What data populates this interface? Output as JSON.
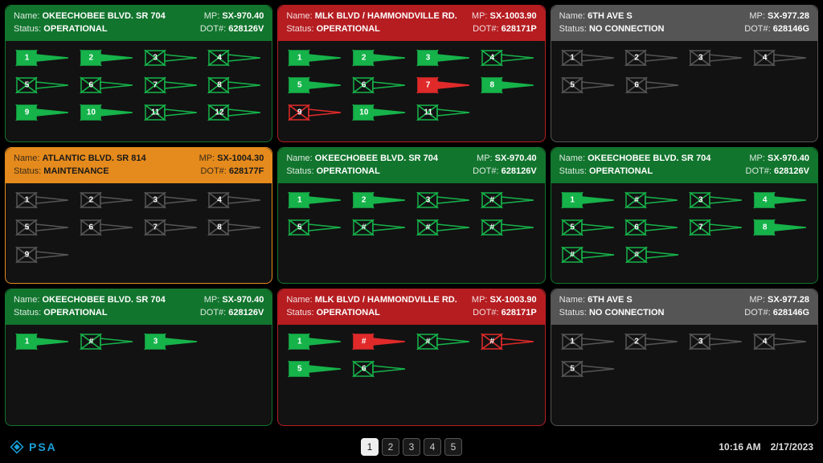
{
  "labels": {
    "name": "Name:",
    "status": "Status:",
    "mp": "MP:",
    "dot": "DOT#:"
  },
  "colors": {
    "green_fill": "#16b34a",
    "green_stroke": "#16b34a",
    "red_fill": "#e02a2a",
    "red_stroke": "#e02a2a",
    "grey_stroke": "#555555",
    "none": "none"
  },
  "footer": {
    "brand": "PSA",
    "pages": [
      "1",
      "2",
      "3",
      "4",
      "5"
    ],
    "active_page": 0,
    "time": "10:16 AM",
    "date": "2/17/2023"
  },
  "cards": [
    {
      "header_class": "green",
      "name": "OKEECHOBEE BLVD. SR 704",
      "status": "OPERATIONAL",
      "mp": "SX-970.40",
      "dot": "628126V",
      "rows": [
        [
          {
            "n": "1",
            "s": "gf"
          },
          {
            "n": "2",
            "s": "gf"
          },
          {
            "n": "3",
            "s": "go"
          },
          {
            "n": "4",
            "s": "go"
          }
        ],
        [
          {
            "n": "5",
            "s": "go"
          },
          {
            "n": "6",
            "s": "go"
          },
          {
            "n": "7",
            "s": "go"
          },
          {
            "n": "8",
            "s": "go"
          }
        ],
        [
          {
            "n": "9",
            "s": "gf"
          },
          {
            "n": "10",
            "s": "gf"
          },
          {
            "n": "11",
            "s": "go"
          },
          {
            "n": "12",
            "s": "go"
          }
        ]
      ]
    },
    {
      "header_class": "red",
      "name": "MLK BLVD / HAMMONDVILLE RD.",
      "status": "OPERATIONAL",
      "mp": "SX-1003.90",
      "dot": "628171P",
      "rows": [
        [
          {
            "n": "1",
            "s": "gf"
          },
          {
            "n": "2",
            "s": "gf"
          },
          {
            "n": "3",
            "s": "gf"
          },
          {
            "n": "4",
            "s": "go"
          }
        ],
        [
          {
            "n": "5",
            "s": "gf"
          },
          {
            "n": "6",
            "s": "go"
          },
          {
            "n": "7",
            "s": "rf"
          },
          {
            "n": "8",
            "s": "gf"
          }
        ],
        [
          {
            "n": "9",
            "s": "ro"
          },
          {
            "n": "10",
            "s": "gf"
          },
          {
            "n": "11",
            "s": "go"
          }
        ]
      ]
    },
    {
      "header_class": "grey",
      "name": "6TH AVE S",
      "status": "NO CONNECTION",
      "mp": "SX-977.28",
      "dot": "628146G",
      "rows": [
        [
          {
            "n": "1",
            "s": "xo"
          },
          {
            "n": "2",
            "s": "xo"
          },
          {
            "n": "3",
            "s": "xo"
          },
          {
            "n": "4",
            "s": "xo"
          }
        ],
        [
          {
            "n": "5",
            "s": "xo"
          },
          {
            "n": "6",
            "s": "xo"
          }
        ]
      ]
    },
    {
      "header_class": "orange",
      "name": "ATLANTIC BLVD. SR 814",
      "status": "MAINTENANCE",
      "mp": "SX-1004.30",
      "dot": "628177F",
      "rows": [
        [
          {
            "n": "1",
            "s": "xo"
          },
          {
            "n": "2",
            "s": "xo"
          },
          {
            "n": "3",
            "s": "xo"
          },
          {
            "n": "4",
            "s": "xo"
          }
        ],
        [
          {
            "n": "5",
            "s": "xo"
          },
          {
            "n": "6",
            "s": "xo"
          },
          {
            "n": "7",
            "s": "xo"
          },
          {
            "n": "8",
            "s": "xo"
          }
        ],
        [
          {
            "n": "9",
            "s": "xo"
          }
        ]
      ]
    },
    {
      "header_class": "green",
      "name": "OKEECHOBEE BLVD. SR 704",
      "status": "OPERATIONAL",
      "mp": "SX-970.40",
      "dot": "628126V",
      "rows": [
        [
          {
            "n": "1",
            "s": "gf"
          },
          {
            "n": "2",
            "s": "gf"
          },
          {
            "n": "3",
            "s": "go"
          },
          {
            "n": "#",
            "s": "go"
          }
        ],
        [
          {
            "n": "5",
            "s": "go"
          },
          {
            "n": "#",
            "s": "go"
          },
          {
            "n": "#",
            "s": "go"
          },
          {
            "n": "#",
            "s": "go"
          }
        ]
      ]
    },
    {
      "header_class": "green",
      "name": "OKEECHOBEE BLVD. SR 704",
      "status": "OPERATIONAL",
      "mp": "SX-970.40",
      "dot": "628126V",
      "rows": [
        [
          {
            "n": "1",
            "s": "gf"
          },
          {
            "n": "#",
            "s": "go"
          },
          {
            "n": "3",
            "s": "go"
          },
          {
            "n": "4",
            "s": "gf"
          }
        ],
        [
          {
            "n": "5",
            "s": "go"
          },
          {
            "n": "6",
            "s": "go"
          },
          {
            "n": "7",
            "s": "go"
          },
          {
            "n": "8",
            "s": "gf"
          }
        ],
        [
          {
            "n": "#",
            "s": "go"
          },
          {
            "n": "#",
            "s": "go"
          }
        ]
      ]
    },
    {
      "header_class": "green",
      "name": "OKEECHOBEE BLVD. SR 704",
      "status": "OPERATIONAL",
      "mp": "SX-970.40",
      "dot": "628126V",
      "rows": [
        [
          {
            "n": "1",
            "s": "gf"
          },
          {
            "n": "#",
            "s": "go"
          },
          {
            "n": "3",
            "s": "gf"
          }
        ]
      ]
    },
    {
      "header_class": "red",
      "name": "MLK BLVD / HAMMONDVILLE RD.",
      "status": "OPERATIONAL",
      "mp": "SX-1003.90",
      "dot": "628171P",
      "rows": [
        [
          {
            "n": "1",
            "s": "gf"
          },
          {
            "n": "#",
            "s": "rf"
          },
          {
            "n": "#",
            "s": "go"
          },
          {
            "n": "#",
            "s": "ro"
          }
        ],
        [
          {
            "n": "5",
            "s": "gf"
          },
          {
            "n": "6",
            "s": "go"
          }
        ]
      ]
    },
    {
      "header_class": "grey",
      "name": "6TH AVE S",
      "status": "NO CONNECTION",
      "mp": "SX-977.28",
      "dot": "628146G",
      "rows": [
        [
          {
            "n": "1",
            "s": "xo"
          },
          {
            "n": "2",
            "s": "xo"
          },
          {
            "n": "3",
            "s": "xo"
          },
          {
            "n": "4",
            "s": "xo"
          }
        ],
        [
          {
            "n": "5",
            "s": "xo"
          }
        ]
      ]
    }
  ]
}
